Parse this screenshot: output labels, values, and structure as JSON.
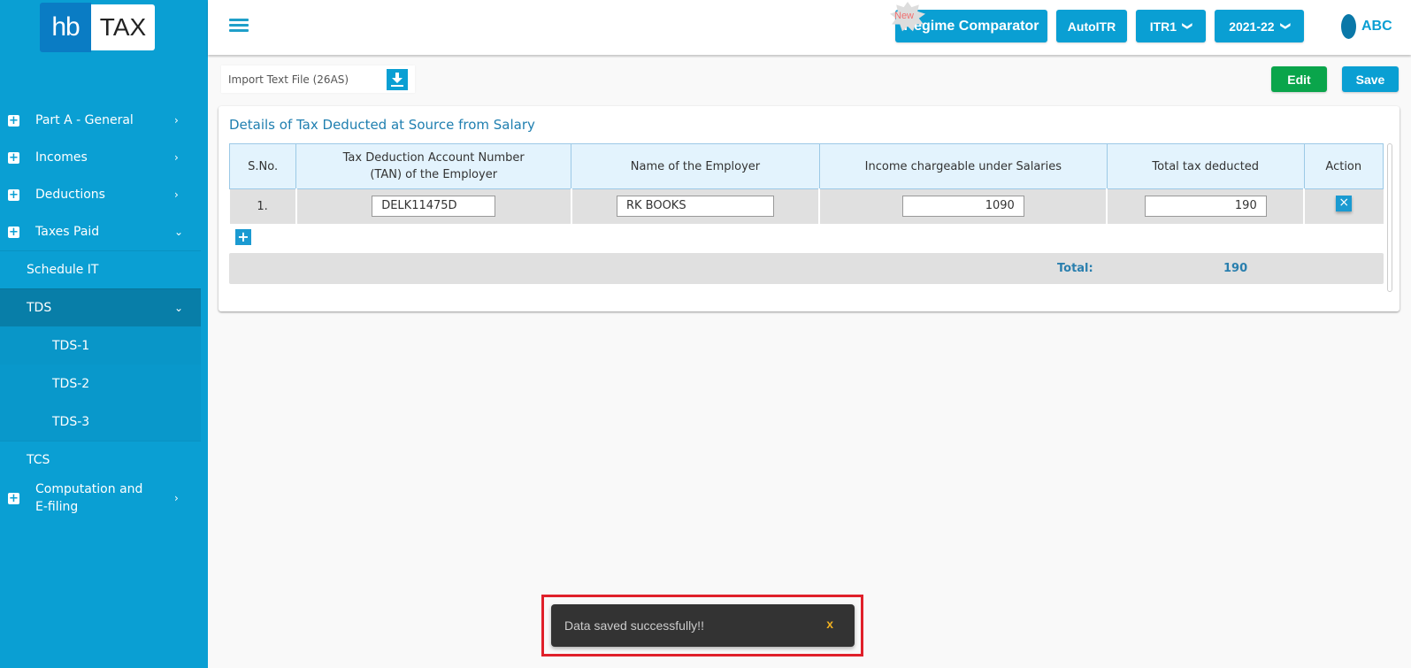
{
  "brand": {
    "logo_left": "hb",
    "logo_right": "TAX"
  },
  "sidebar": {
    "items": [
      {
        "label": "Part A - General",
        "icon": "plus-square-icon",
        "chevron": "chevron-right-icon"
      },
      {
        "label": "Incomes",
        "icon": "plus-square-icon",
        "chevron": "chevron-right-icon"
      },
      {
        "label": "Deductions",
        "icon": "plus-square-icon",
        "chevron": "chevron-right-icon"
      },
      {
        "label": "Taxes Paid",
        "icon": "plus-square-icon",
        "chevron": "chevron-down-icon"
      }
    ],
    "taxes_paid_children": [
      {
        "label": "Schedule IT"
      },
      {
        "label": "TDS",
        "active": true
      },
      {
        "label": "TCS"
      }
    ],
    "tds_children": [
      {
        "label": "TDS-1"
      },
      {
        "label": "TDS-2"
      },
      {
        "label": "TDS-3"
      }
    ],
    "last_item": {
      "label": "Computation and E-filing"
    },
    "chev_right": "›",
    "chev_down": "⌄",
    "plus": "+"
  },
  "header": {
    "new_badge": "New",
    "regime_comparator": "Regime Comparator",
    "auto_itr": "AutoITR",
    "itr_select": "ITR1",
    "year_select": "2021-22",
    "caret": "❯",
    "user_name": "ABC"
  },
  "toolbar": {
    "import_label": "Import Text File (26AS)",
    "edit_label": "Edit",
    "save_label": "Save"
  },
  "card": {
    "title": "Details of Tax Deducted at Source from Salary",
    "columns": [
      "S.No.",
      "Tax Deduction Account Number",
      "(TAN) of the Employer",
      "Name of the Employer",
      "Income chargeable under Salaries",
      "Total tax deducted",
      "Action"
    ],
    "rows": [
      {
        "sno": "1.",
        "tan": "DELK11475D",
        "employer": "RK BOOKS",
        "income": "1090",
        "tax": "190",
        "delete": "×"
      }
    ],
    "add_label": "+",
    "total_label": "Total:",
    "total_value": "190"
  },
  "toast": {
    "message": "Data saved successfully!!",
    "close": "x"
  },
  "colors": {
    "primary": "#0a9fd3",
    "sidebar_active": "#087ea8",
    "edit_green": "#0aa54b",
    "toast_bg": "#333333",
    "highlight_red": "#e0202a"
  }
}
